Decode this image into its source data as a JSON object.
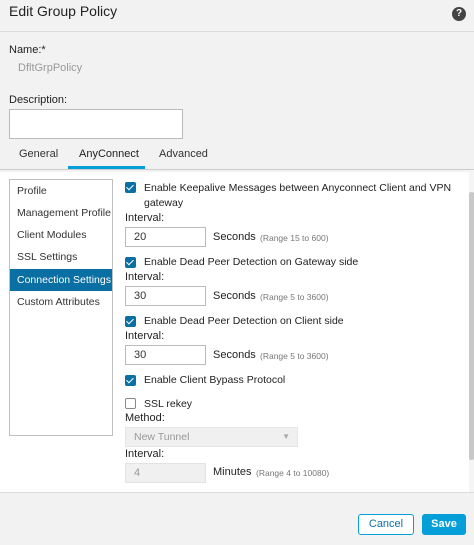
{
  "dialog": {
    "title": "Edit Group Policy",
    "help_icon": "?"
  },
  "form": {
    "name_label": "Name:*",
    "name_value": "DfltGrpPolicy",
    "description_label": "Description:",
    "description_value": ""
  },
  "tabs": [
    {
      "label": "General"
    },
    {
      "label": "AnyConnect",
      "active": true
    },
    {
      "label": "Advanced"
    }
  ],
  "sidebar": {
    "items": [
      {
        "label": "Profile"
      },
      {
        "label": "Management Profile"
      },
      {
        "label": "Client Modules"
      },
      {
        "label": "SSL Settings"
      },
      {
        "label": "Connection Settings",
        "active": true
      },
      {
        "label": "Custom Attributes"
      }
    ]
  },
  "connection": {
    "keepalive": {
      "label": "Enable Keepalive Messages between Anyconnect Client and VPN gateway",
      "label_line1": "Enable Keepalive Messages between Anyconnect Client and VPN",
      "label_line2": "gateway",
      "checked": true,
      "interval_label": "Interval:",
      "value": "20",
      "unit": "Seconds",
      "range": "(Range 15 to 600)"
    },
    "dpd_gateway": {
      "label": "Enable Dead Peer Detection on Gateway side",
      "checked": true,
      "interval_label": "Interval:",
      "value": "30",
      "unit": "Seconds",
      "range": "(Range 5 to 3600)"
    },
    "dpd_client": {
      "label": "Enable Dead Peer Detection on Client side",
      "checked": true,
      "interval_label": "Interval:",
      "value": "30",
      "unit": "Seconds",
      "range": "(Range 5 to 3600)"
    },
    "bypass": {
      "label": "Enable Client Bypass Protocol",
      "checked": true
    },
    "ssl_rekey": {
      "label": "SSL rekey",
      "checked": false,
      "method_label": "Method:",
      "method_value": "New Tunnel",
      "interval_label": "Interval:",
      "value": "4",
      "unit": "Minutes",
      "range": "(Range 4 to 10080)"
    }
  },
  "footer": {
    "cancel_label": "Cancel",
    "save_label": "Save"
  },
  "colors": {
    "accent": "#049fd9",
    "active_nav": "#0a6fa3",
    "panel_bg": "#f2f2f2"
  }
}
